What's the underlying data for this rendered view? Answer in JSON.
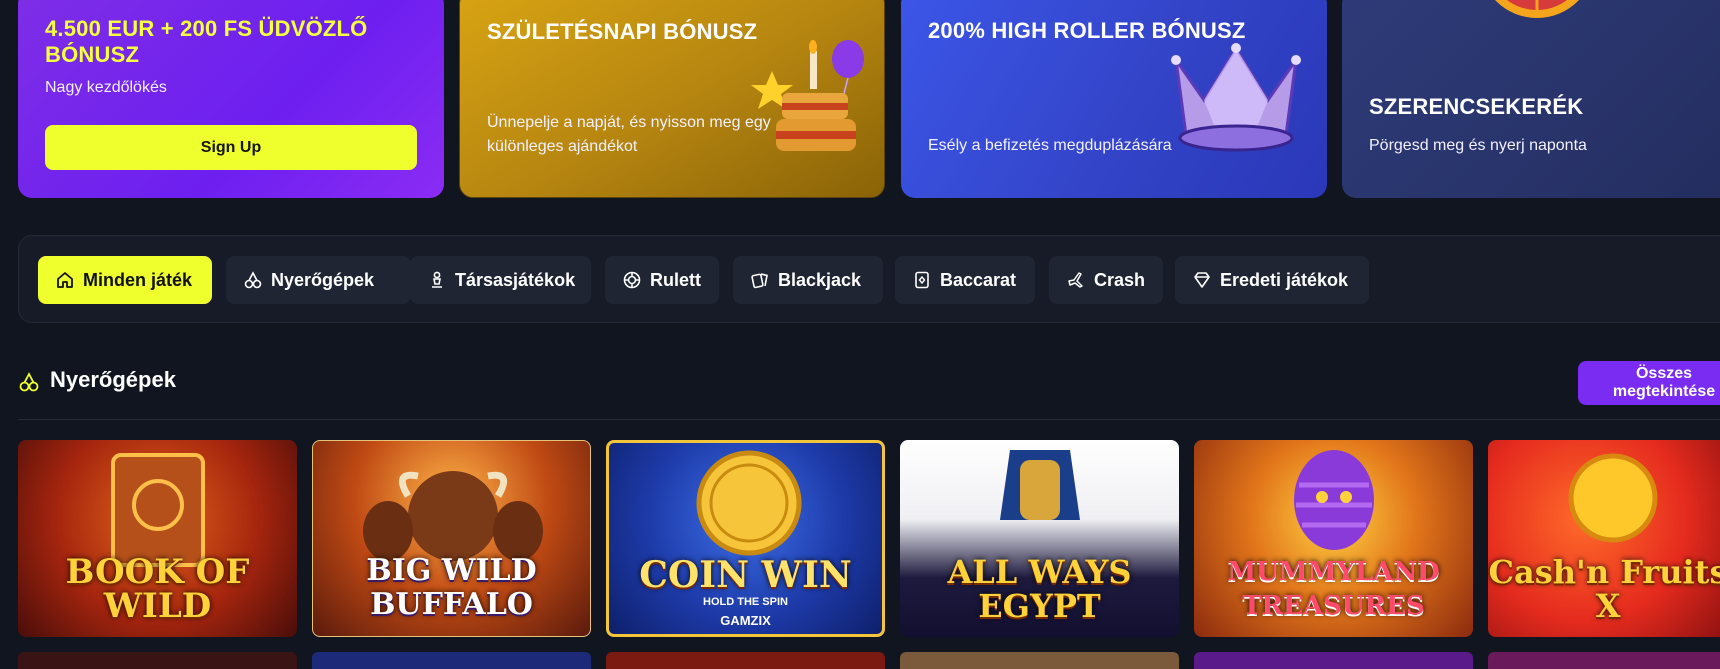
{
  "promos": [
    {
      "title": "4.500 EUR + 200 FS ÜDVÖZLŐ BÓNUSZ",
      "desc": "Nagy kezdőlökés",
      "button": "Sign Up"
    },
    {
      "title": "SZÜLETÉSNAPI BÓNUSZ",
      "desc": "Ünnepelje a napját, és nyisson meg egy különleges ajándékot"
    },
    {
      "title": "200% HIGH ROLLER BÓNUSZ",
      "desc": "Esély a befizetés megduplázására"
    },
    {
      "title": "SZERENCSEKERÉK",
      "desc": "Pörgesd meg és nyerj naponta"
    }
  ],
  "categories": [
    {
      "label": "Minden játék",
      "icon": "home-icon",
      "active": true
    },
    {
      "label": "Nyerőgépek",
      "icon": "cherries-icon"
    },
    {
      "label": "Társasjátékok",
      "icon": "pawn-icon"
    },
    {
      "label": "Rulett",
      "icon": "roulette-icon"
    },
    {
      "label": "Blackjack",
      "icon": "cards-icon"
    },
    {
      "label": "Baccarat",
      "icon": "card-icon"
    },
    {
      "label": "Crash",
      "icon": "plane-icon"
    },
    {
      "label": "Eredeti játékok",
      "icon": "diamond-icon"
    }
  ],
  "section": {
    "title": "Nyerőgépek",
    "icon": "cherries-icon",
    "see_all": "Összes megtekintése"
  },
  "games": [
    {
      "name": "BOOK OF WILD"
    },
    {
      "name": "BIG WILD BUFFALO"
    },
    {
      "name": "COIN WIN",
      "subtitle": "HOLD THE SPIN",
      "provider": "GAMZIX"
    },
    {
      "name": "ALL WAYS EGYPT"
    },
    {
      "name": "MUMMYLAND TREASURES"
    },
    {
      "name": "Cash'n Fruits X"
    }
  ],
  "colors": {
    "accent": "#efff2e",
    "purple": "#7a2cf2",
    "bg": "#111520"
  }
}
